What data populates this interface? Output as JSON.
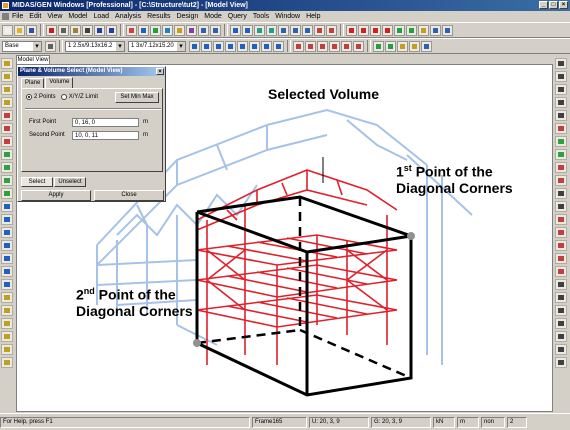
{
  "window": {
    "title": "MIDAS/GEN Windows [Professional] - [C:\\Structure\\tut2] - [Model View]",
    "buttons": [
      "_",
      "□",
      "×"
    ]
  },
  "menu": [
    "File",
    "Edit",
    "View",
    "Model",
    "Load",
    "Analysis",
    "Results",
    "Design",
    "Mode",
    "Query",
    "Tools",
    "Window",
    "Help"
  ],
  "toolbar": {
    "combo_base": "Base",
    "combo_section1": "1 2.5x/9.13x16.2",
    "combo_section2": "1 3x/7.12x15.20"
  },
  "view_tab": "Model View",
  "dialog": {
    "title": "Plane & Volume Select (Model View)",
    "close": "×",
    "tabs": [
      "Plane",
      "Volume"
    ],
    "active_tab": "Volume",
    "radio_2points": "2 Points",
    "radio_xyz": "X/Y/Z Limit",
    "minmax_button": "Set Min Max",
    "first_point_label": "First Point",
    "first_point_value": "0, 16, 0",
    "second_point_label": "Second Point",
    "second_point_value": "10, 0, 11",
    "unit": "m",
    "select_tab": "Select",
    "unselect_tab": "Unselect",
    "apply": "Apply",
    "close_button": "Close"
  },
  "annotations": {
    "selected_volume": "Selected Volume",
    "first_sup": "st",
    "first_num": "1",
    "first_rest": " Point of the",
    "first_line2": "Diagonal Corners",
    "second_num": "2",
    "second_sup": "nd",
    "second_rest": " Point of the",
    "second_line2": "Diagonal Corners"
  },
  "status": {
    "help": "For Help, press F1",
    "frame": "Frame165",
    "u": "U: 20, 3, 9",
    "g": "G: 20, 3, 9",
    "unit1": "kN",
    "unit2": "m",
    "mode": "non",
    "page": "2"
  },
  "colors": {
    "structure": "#a6c2e8",
    "selected": "#e0202a",
    "box": "#000000"
  }
}
